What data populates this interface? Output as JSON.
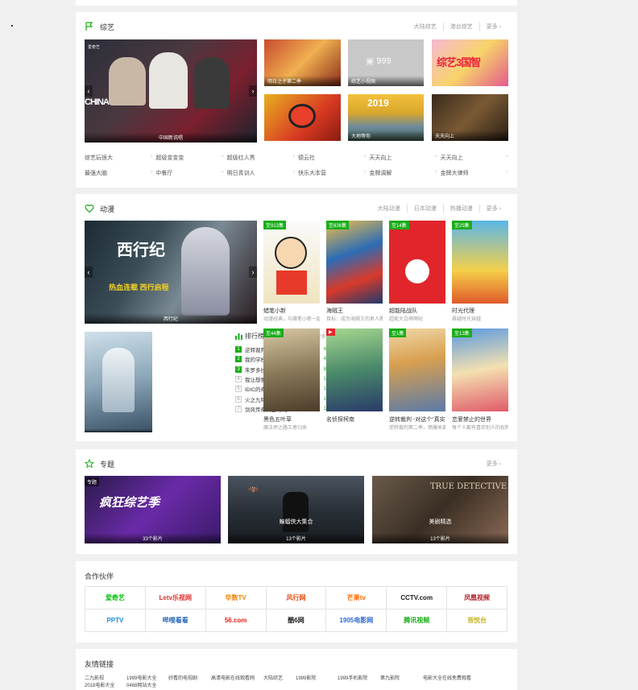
{
  "variety": {
    "title": "综艺",
    "links": [
      "大陆综艺",
      "港台综艺",
      "更多"
    ],
    "hero_caption": "中国新说唱",
    "hero_badge": "爱奇艺",
    "tiles": [
      {
        "caption": "明日之子第二季"
      },
      {
        "caption": "综艺小视频"
      },
      {
        "caption": ""
      },
      {
        "caption": ""
      },
      {
        "caption": "大地等你"
      },
      {
        "caption": "天天向上"
      }
    ],
    "hero_logo_text": "CHINA",
    "grid_links": [
      "综艺玩很大",
      "超级变变变",
      "超级红人秀",
      "德云社",
      "天天向上",
      "天天向上",
      "最强大脑",
      "中餐厅",
      "明日青训人",
      "快乐大本营",
      "金牌调解",
      "金牌大律师"
    ]
  },
  "anime": {
    "title": "动漫",
    "links": [
      "大陆动漫",
      "日本动漫",
      "热播动漫",
      "更多"
    ],
    "hero_caption": "西行纪",
    "hero_title_art": "西行纪",
    "hero_slogan": "热血连载 西行启程",
    "items_top": [
      {
        "tag": "至913集",
        "title": "蜡笔小新",
        "sub": "动漫经典，与蜡笔小新一起欢乐"
      },
      {
        "tag": "至836集",
        "title": "海贼王",
        "sub": "目标：成为海贼王的男人路飞"
      },
      {
        "tag": "至14集",
        "title": "超能陆战队",
        "sub": "超能大白萌萌哒"
      },
      {
        "tag": "至25集",
        "title": "时光代理",
        "sub": "悬疑时光穿越"
      }
    ],
    "items_bottom": [
      {
        "tag": "至44集",
        "title": "黑色五叶草",
        "sub": "魔法帝之路王者归来"
      },
      {
        "tag": "",
        "title": "名侦探柯南",
        "sub": ""
      },
      {
        "tag": "至1集",
        "title": "逆转裁判 -对这个“真实”",
        "sub": "逆转裁判第二季，燃爆来袭"
      },
      {
        "tag": "至13集",
        "title": "恋爱禁止的世界",
        "sub": "每个人都有喜欢别人的权利"
      }
    ],
    "left_poster_caption": "",
    "rank": {
      "title": "排行榜",
      "more": "更多",
      "rows": [
        {
          "num": "1",
          "name": "逆转裁判 -对这个“真实”",
          "score": "4.0"
        },
        {
          "num": "2",
          "name": "我的学校的女朋友",
          "score": "4.0"
        },
        {
          "num": "3",
          "name": "朱罗多拉世界的撞天",
          "score": "8.0"
        },
        {
          "num": "4",
          "name": "我让想要找新相男人称成为了",
          "score": "1.0"
        },
        {
          "num": "5",
          "name": "IDIC的奇妙冒险 黄金之风",
          "score": "1.0"
        },
        {
          "num": "6",
          "name": "火之九特护",
          "score": "1.0"
        },
        {
          "num": "7",
          "name": "剑风传奇黄金时代",
          "score": "1.0"
        }
      ]
    }
  },
  "topics": {
    "title": "专题",
    "more": "更多",
    "items": [
      {
        "title": "疯狂综艺季",
        "sub": "33个影片"
      },
      {
        "title": "蝙蝠侠大集合",
        "sub": "13个影片"
      },
      {
        "title": "美剧精选",
        "sub": "13个影片"
      }
    ],
    "badge": "专题"
  },
  "partners": {
    "title": "合作伙伴",
    "items": [
      {
        "name": "爱奇艺",
        "color": "#00be06"
      },
      {
        "name": "Letv乐视网",
        "color": "#e5302f"
      },
      {
        "name": "华数TV",
        "color": "#f08300"
      },
      {
        "name": "风行网",
        "color": "#e84c0c"
      },
      {
        "name": "芒果tv",
        "color": "#ff6a00"
      },
      {
        "name": "CCTV.com",
        "color": "#1a1a1a"
      },
      {
        "name": "凤凰视频",
        "color": "#b3282d"
      },
      {
        "name": "PPTV",
        "color": "#1a8fe2"
      },
      {
        "name": "哔哩看看",
        "color": "#2a69b8"
      },
      {
        "name": "56.com",
        "color": "#e0201c"
      },
      {
        "name": "酷6网",
        "color": "#222222"
      },
      {
        "name": "1905电影网",
        "color": "#2d6bd3"
      },
      {
        "name": "腾讯视频",
        "color": "#1aad19"
      },
      {
        "name": "音悦台",
        "color": "#c7b32a"
      }
    ]
  },
  "friends": {
    "title": "友情链接",
    "items": [
      "二九影视",
      "1999电影大全",
      "好看的电视剧",
      "高清电影在线观看网",
      "大陆综艺",
      "1999影院",
      "1999手机影院",
      "第九影院",
      "电影大全在线免费观看",
      "2018电影大全",
      "0468网站大全"
    ]
  }
}
